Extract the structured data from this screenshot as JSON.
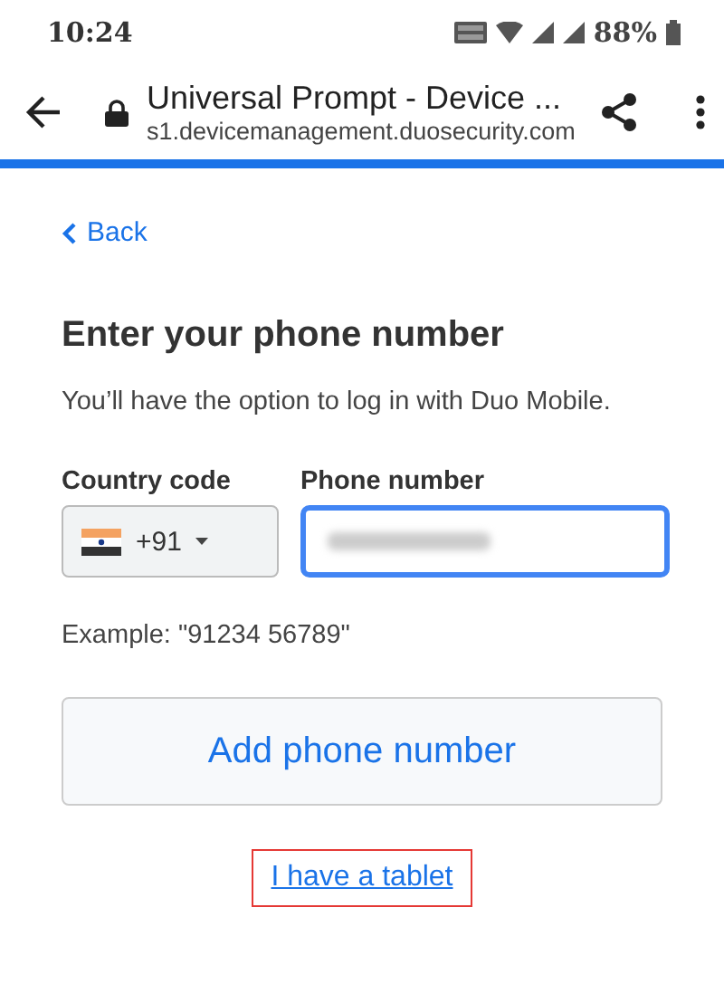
{
  "status_bar": {
    "time": "10:24",
    "battery": "88%"
  },
  "browser": {
    "title": "Universal Prompt - Device ...",
    "url": "s1.devicemanagement.duosecurity.com"
  },
  "back_link": {
    "label": "Back"
  },
  "heading": "Enter your phone number",
  "subtitle": "You’ll have the option to log in with Duo Mobile.",
  "country_code": {
    "label": "Country code",
    "value": "+91"
  },
  "phone_number": {
    "label": "Phone number",
    "focused": true
  },
  "example": "Example: \"91234 56789\"",
  "submit_button": {
    "label": "Add phone number"
  },
  "tablet_link": {
    "label": "I have a tablet",
    "highlighted": true
  }
}
